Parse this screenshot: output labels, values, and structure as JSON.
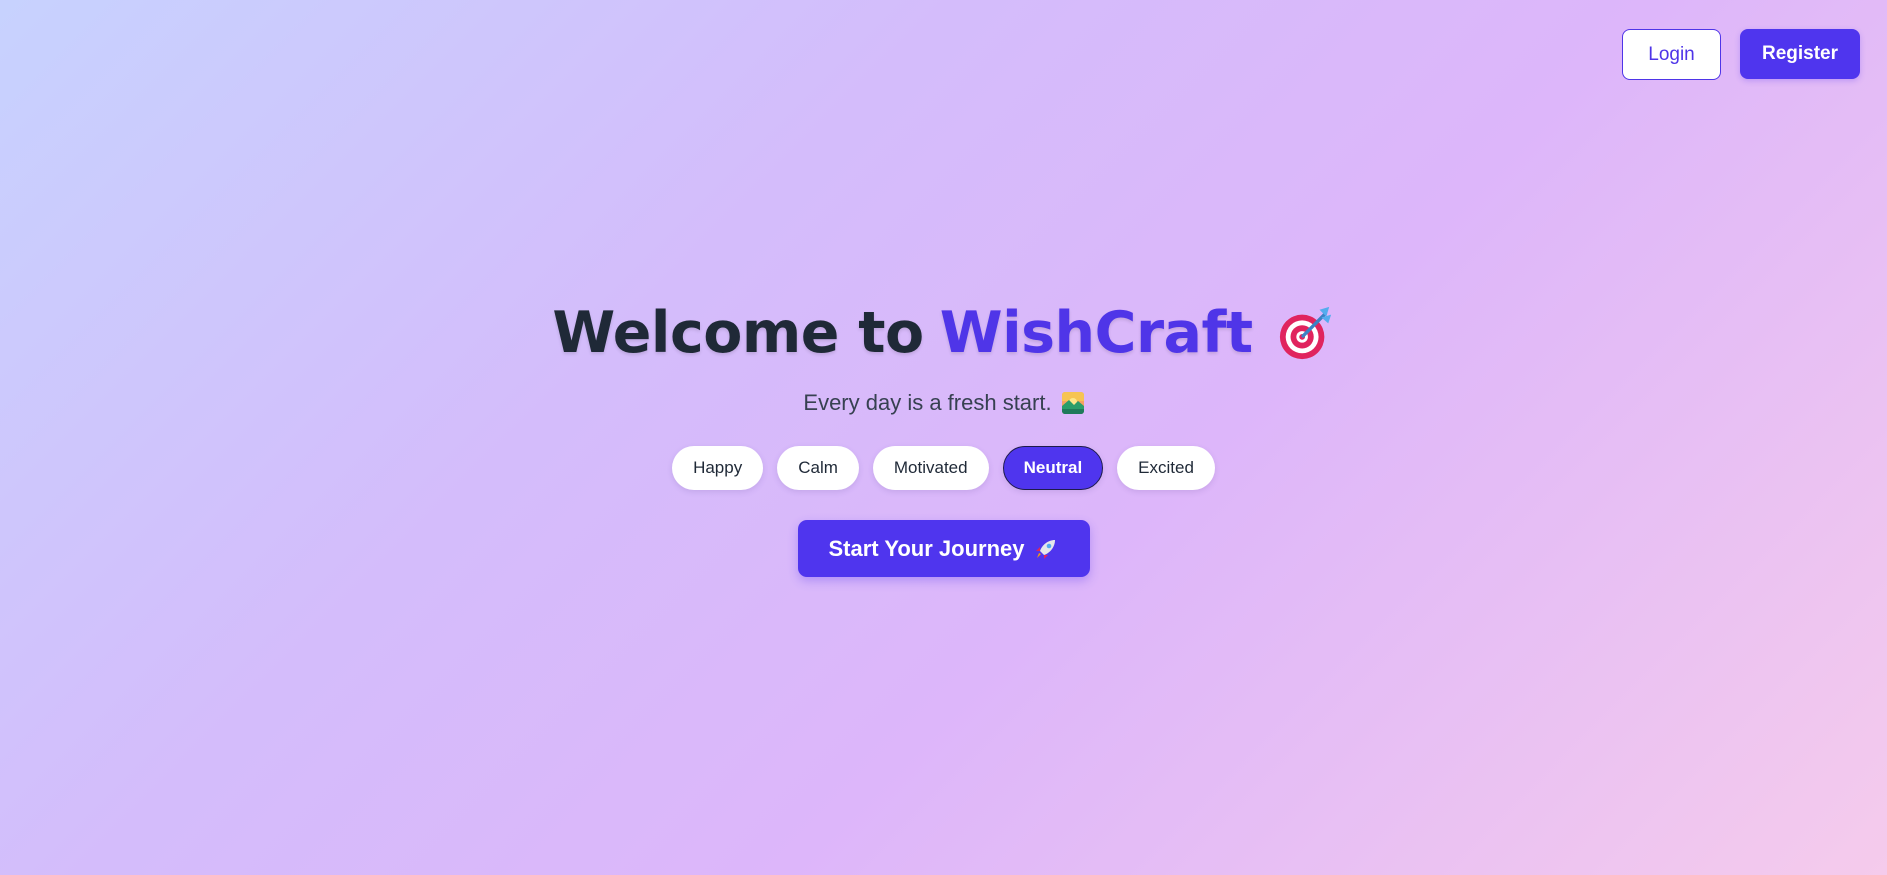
{
  "header": {
    "login_label": "Login",
    "register_label": "Register"
  },
  "hero": {
    "title_prefix": "Welcome to",
    "brand_name": "WishCraft",
    "title_icon": "target-icon",
    "subtitle": "Every day is a fresh start.",
    "subtitle_icon": "sunrise-icon"
  },
  "moods": [
    {
      "label": "Happy",
      "selected": false
    },
    {
      "label": "Calm",
      "selected": false
    },
    {
      "label": "Motivated",
      "selected": false
    },
    {
      "label": "Neutral",
      "selected": true
    },
    {
      "label": "Excited",
      "selected": false
    }
  ],
  "cta": {
    "label": "Start Your Journey",
    "icon": "rocket-icon"
  },
  "colors": {
    "accent": "#4f35ee",
    "title_text": "#1f2937",
    "subtitle_text": "#374151"
  }
}
